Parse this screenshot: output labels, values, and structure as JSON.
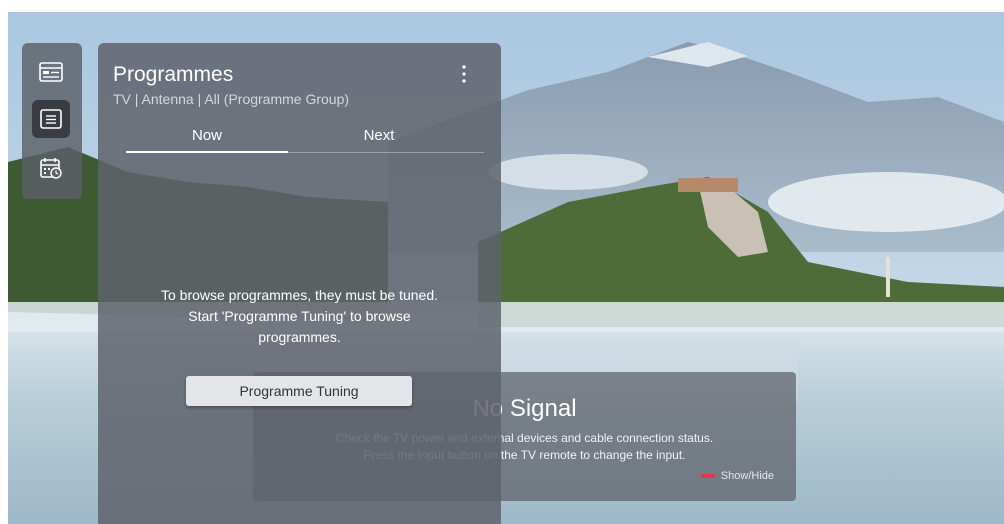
{
  "rail": {
    "items": [
      {
        "name": "guide-icon",
        "active": false
      },
      {
        "name": "programme-list-icon",
        "active": true
      },
      {
        "name": "schedule-icon",
        "active": false
      }
    ]
  },
  "panel": {
    "title": "Programmes",
    "subtitle": "TV | Antenna | All (Programme Group)",
    "tabs": [
      {
        "label": "Now",
        "selected": true
      },
      {
        "label": "Next",
        "selected": false
      }
    ],
    "empty_message": "To browse programmes, they must be tuned. Start 'Programme Tuning' to browse programmes.",
    "tune_button_label": "Programme Tuning",
    "more_icon": "more-vert-icon"
  },
  "no_signal": {
    "title": "No Signal",
    "line1": "Check the TV power and external devices and cable connection status.",
    "line2": "Press the Input button on the TV remote to change the input.",
    "hint_key_color": "#e8344a",
    "hint_label": "Show/Hide"
  }
}
